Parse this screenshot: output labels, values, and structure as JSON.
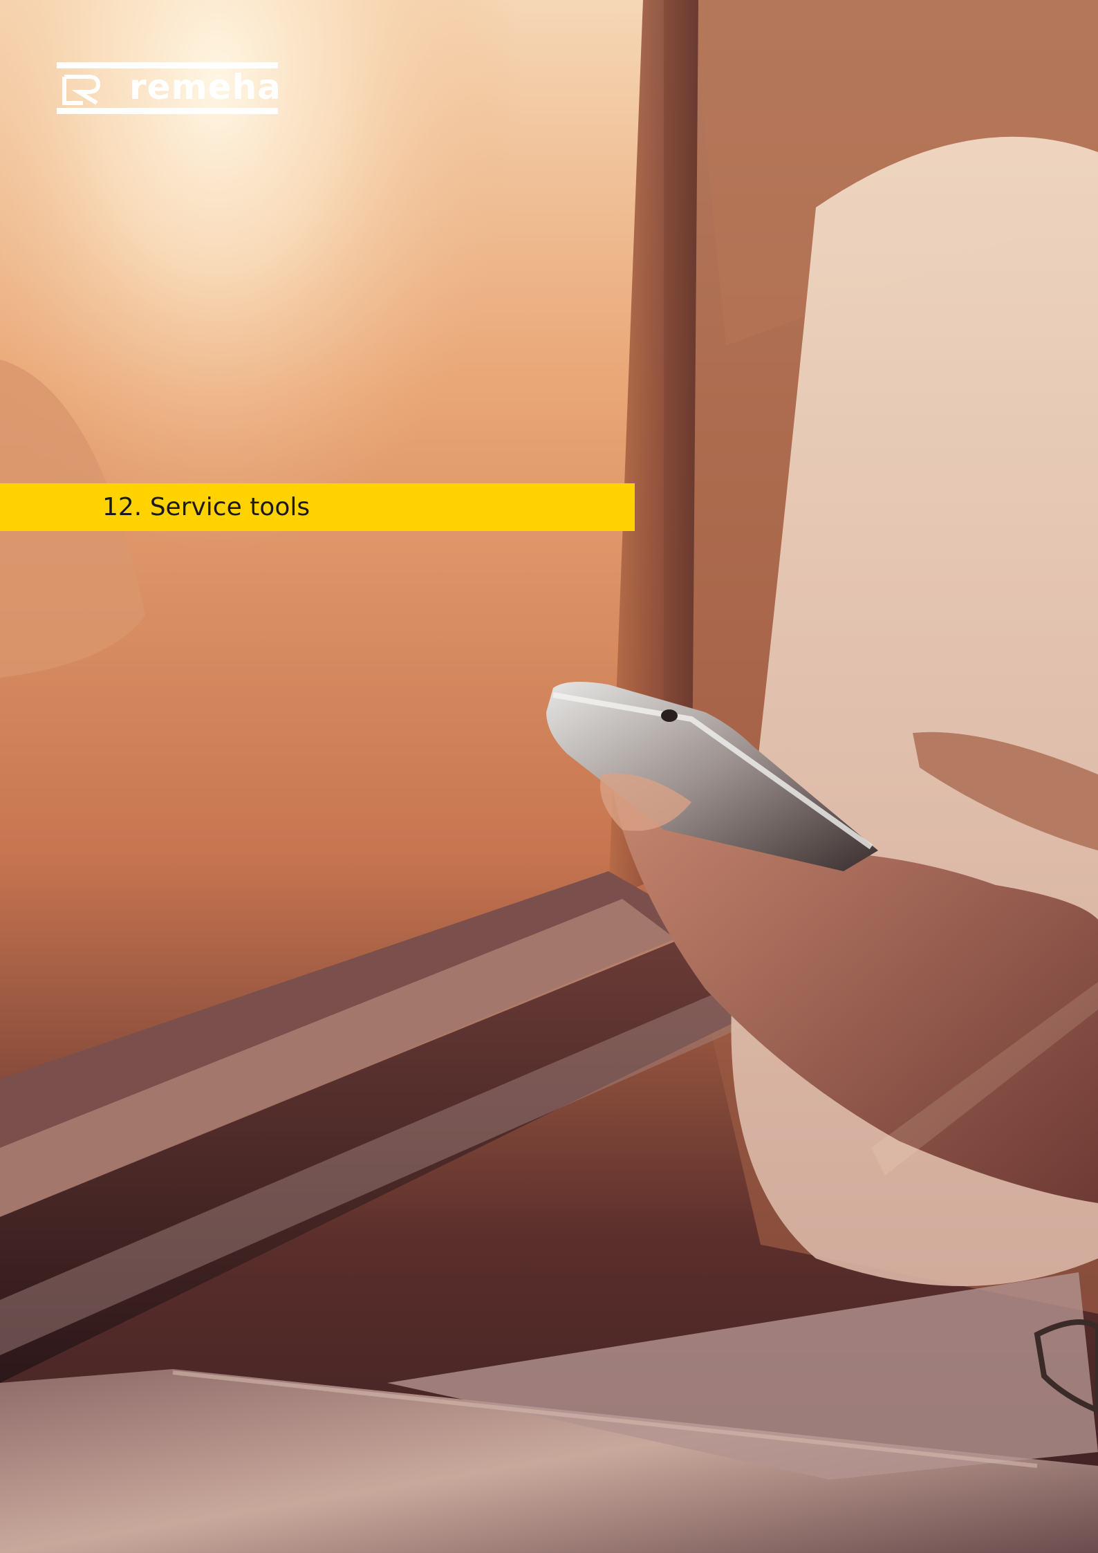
{
  "brand": {
    "logo_text": "remeha",
    "logo_icon": "remeha-logo-icon"
  },
  "chapter": {
    "title": "12. Service tools",
    "band_color": "#ffd200"
  },
  "photo": {
    "icon": "phone-in-hand-photo"
  }
}
